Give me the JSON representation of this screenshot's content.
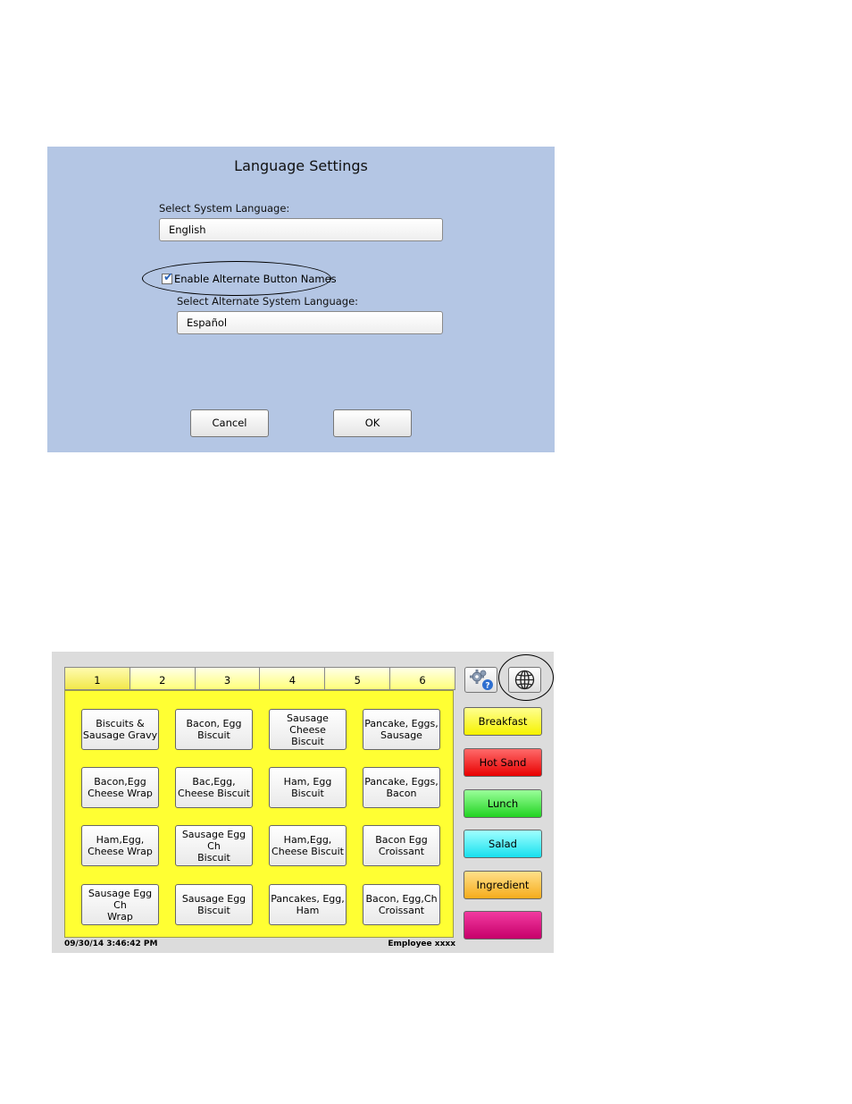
{
  "language_settings": {
    "title": "Language Settings",
    "system_language_label": "Select System Language:",
    "system_language_value": "English",
    "enable_alternate_label": "Enable Alternate Button Names",
    "enable_alternate_checked": true,
    "alternate_language_label": "Select Alternate System Language:",
    "alternate_language_value": "Español",
    "cancel_label": "Cancel",
    "ok_label": "OK"
  },
  "pos": {
    "tabs": [
      "1",
      "2",
      "3",
      "4",
      "5",
      "6"
    ],
    "active_tab": "1",
    "items": [
      [
        "Biscuits &\nSausage Gravy",
        "Bacon, Egg\nBiscuit",
        "Sausage Cheese\nBiscuit",
        "Pancake,  Eggs,\nSausage"
      ],
      [
        "Bacon,Egg\nCheese Wrap",
        "Bac,Egg,\nCheese Biscuit",
        "Ham, Egg\nBiscuit",
        "Pancake,  Eggs,\nBacon"
      ],
      [
        "Ham,Egg,\nCheese Wrap",
        "Sausage Egg Ch\nBiscuit",
        "Ham,Egg,\nCheese Biscuit",
        "Bacon Egg\nCroissant"
      ],
      [
        "Sausage Egg Ch\nWrap",
        "Sausage  Egg\nBiscuit",
        "Pancakes,  Egg,\nHam",
        "Bacon, Egg,Ch\nCroissant"
      ]
    ],
    "categories": {
      "breakfast": "Breakfast",
      "hot_sand": "Hot Sand",
      "lunch": "Lunch",
      "salad": "Salad",
      "ingredient": "Ingredient",
      "blank": ""
    },
    "icons": {
      "settings": "gear-help-icon",
      "language": "globe-icon"
    },
    "status": {
      "datetime": "09/30/14  3:46:42 PM",
      "employee": "Employee xxxx"
    }
  }
}
